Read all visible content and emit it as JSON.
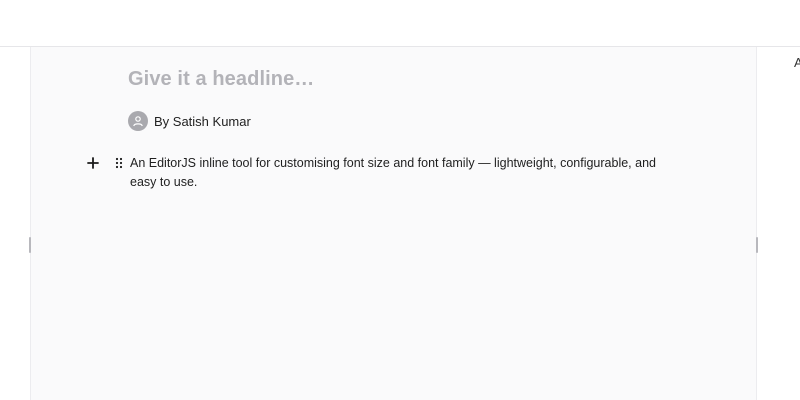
{
  "editor": {
    "headline_placeholder": "Give it a headline…",
    "byline": "By Satish Kumar",
    "paragraph": "An EditorJS inline tool for customising  font size and  font family — lightweight, configurable, and easy to use."
  },
  "side_panel": {
    "clipped_text": "A"
  },
  "icons": {
    "avatar": "user-icon",
    "add": "plus-icon",
    "drag": "drag-handle-icon"
  },
  "colors": {
    "canvas_bg": "#fafafb",
    "placeholder": "#b3b3b8",
    "avatar_bg": "#a9a9ae"
  }
}
